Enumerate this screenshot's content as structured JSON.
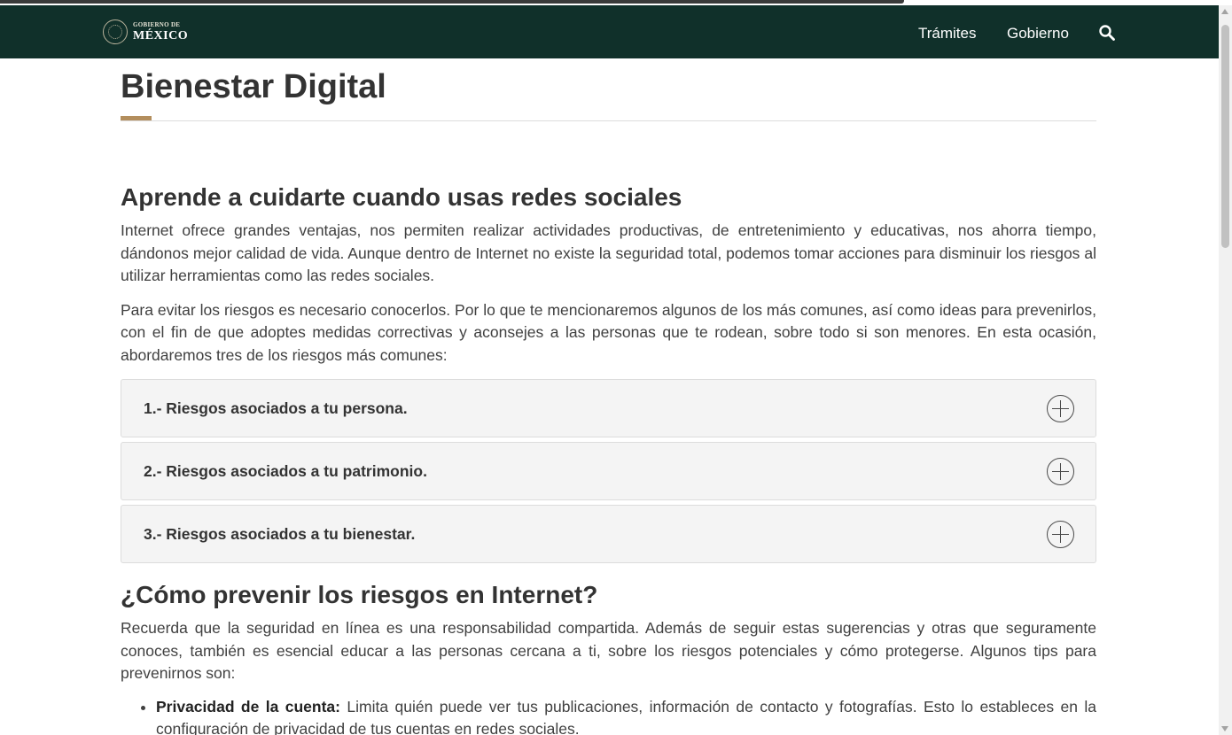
{
  "header": {
    "logo_small": "GOBIERNO DE",
    "logo_big": "MÉXICO",
    "nav": [
      "Trámites",
      "Gobierno"
    ],
    "search_icon": "search-icon"
  },
  "page": {
    "title": "Bienestar Digital"
  },
  "section1": {
    "heading": "Aprende a cuidarte cuando usas redes sociales",
    "p1": "Internet ofrece grandes ventajas, nos permiten realizar actividades productivas, de entretenimiento y educativas, nos ahorra tiempo, dándonos mejor calidad de vida. Aunque dentro de Internet no existe la seguridad total, podemos tomar acciones para disminuir los riesgos al utilizar herramientas como las redes sociales.",
    "p2": "Para evitar los riesgos es necesario conocerlos. Por lo que te mencionaremos algunos de los más comunes, así como ideas para prevenirlos, con el fin de que adoptes medidas correctivas y aconsejes a las personas que te rodean, sobre todo si son menores. En esta ocasión, abordaremos tres de los riesgos más comunes:"
  },
  "accordion": [
    {
      "label": "1.- Riesgos asociados a tu persona."
    },
    {
      "label": "2.- Riesgos asociados a tu patrimonio."
    },
    {
      "label": "3.- Riesgos asociados a tu bienestar."
    }
  ],
  "section2": {
    "heading": "¿Cómo prevenir los riesgos en Internet?",
    "p1": "Recuerda que la seguridad en línea es una responsabilidad compartida. Además de seguir estas sugerencias y otras que seguramente conoces, también es esencial educar a las personas cercana a ti, sobre los riesgos potenciales y cómo protegerse. Algunos tips para prevenirnos son:",
    "tips": [
      {
        "title": "Privacidad de la cuenta:",
        "text": " Limita quién puede ver tus publicaciones, información de contacto y fotografías. Esto lo estableces en la configuración de privacidad de tus cuentas en redes sociales."
      }
    ]
  },
  "colors": {
    "navbar": "#10302a",
    "accent": "#b38e5d",
    "text": "#333333"
  }
}
